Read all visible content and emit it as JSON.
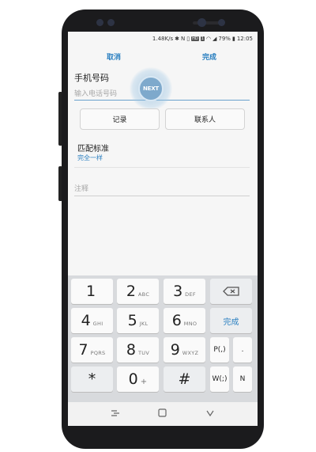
{
  "status": {
    "net_speed": "1.48K/s",
    "signal_text": "79%",
    "time": "12:05",
    "hd_badge": "HD",
    "sim_badge": "1"
  },
  "actionbar": {
    "cancel_label": "取消",
    "done_label": "完成"
  },
  "phone_field": {
    "label": "手机号码",
    "placeholder": "输入电话号码"
  },
  "next_overlay": {
    "label": "NEXT"
  },
  "buttons": {
    "log_label": "记录",
    "contacts_label": "联系人"
  },
  "match": {
    "title": "匹配标准",
    "value": "完全一样"
  },
  "notes": {
    "placeholder": "注释"
  },
  "keyboard": {
    "keys": [
      {
        "num": "1",
        "sub": ""
      },
      {
        "num": "2",
        "sub": "ABC"
      },
      {
        "num": "3",
        "sub": "DEF"
      },
      {
        "num": "4",
        "sub": "GHI"
      },
      {
        "num": "5",
        "sub": "JKL"
      },
      {
        "num": "6",
        "sub": "MNO"
      },
      {
        "num": "7",
        "sub": "PQRS"
      },
      {
        "num": "8",
        "sub": "TUV"
      },
      {
        "num": "9",
        "sub": "WXYZ"
      },
      {
        "num": "*",
        "sub": ""
      },
      {
        "num": "0",
        "sub": "+"
      },
      {
        "num": "#",
        "sub": ""
      }
    ],
    "done_label": "完成",
    "pause_label": "P(,)",
    "dot_label": ".",
    "wait_label": "W(;)",
    "n_label": "N",
    "delete_icon": "backspace-icon"
  },
  "navbar": {
    "recent_icon": "recent-apps-icon",
    "home_icon": "home-icon",
    "back_icon": "back-icon"
  }
}
